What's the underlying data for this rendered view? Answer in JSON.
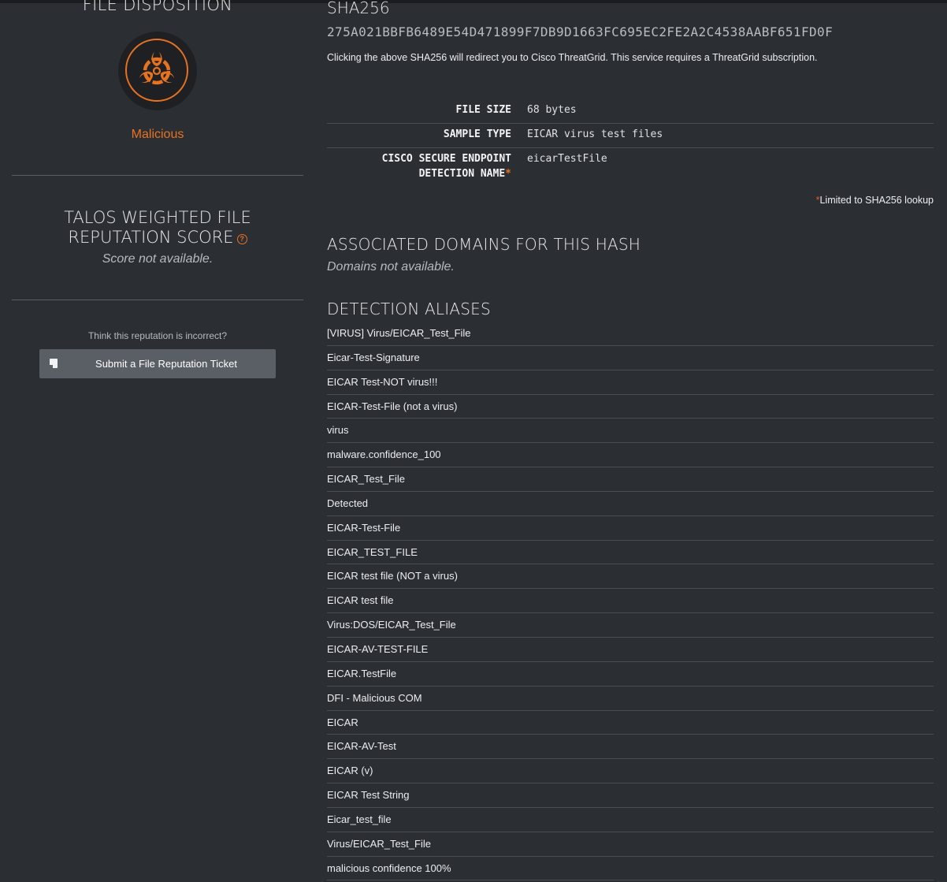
{
  "left": {
    "disposition_title": "FILE DISPOSITION",
    "disposition_icon": "biohazard-icon",
    "disposition_label": "Malicious",
    "score_title": "TALOS WEIGHTED FILE REPUTATION SCORE",
    "help_icon": "question-icon",
    "score_value": "Score not available.",
    "incorrect_prompt": "Think this reputation is incorrect?",
    "ticket_button_label": "Submit a File Reputation Ticket",
    "ticket_icon": "document-icon"
  },
  "right": {
    "sha_title": "SHA256",
    "sha_value": "275A021BBFB6489E54D471899F7DB9D1663FC695EC2FE2A2C4538AABF651FD0F",
    "sha_note": "Clicking the above SHA256 will redirect you to Cisco ThreatGrid. This service requires a ThreatGrid subscription.",
    "file_size_label": "FILE SIZE",
    "file_size_value": "68 bytes",
    "sample_type_label": "SAMPLE TYPE",
    "sample_type_value": "EICAR virus test files",
    "detection_label_line1": "CISCO SECURE ENDPOINT",
    "detection_label_line2": "DETECTION NAME",
    "detection_asterisk": "*",
    "detection_value": "eicarTestFile",
    "limit_asterisk": "*",
    "limit_note": "Limited to SHA256 lookup",
    "domains_title": "ASSOCIATED DOMAINS FOR THIS HASH",
    "domains_value": "Domains not available.",
    "aliases_title": "DETECTION ALIASES",
    "aliases": [
      "[VIRUS] Virus/EICAR_Test_File",
      "Eicar-Test-Signature",
      "EICAR Test-NOT virus!!!",
      "EICAR-Test-File (not a virus)",
      "virus",
      "malware.confidence_100",
      "EICAR_Test_File",
      "Detected",
      "EICAR-Test-File",
      "EICAR_TEST_FILE",
      "EICAR test file (NOT a virus)",
      "EICAR test file",
      "Virus:DOS/EICAR_Test_File",
      "EICAR-AV-TEST-FILE",
      "EICAR.TestFile",
      "DFI - Malicious COM",
      "EICAR",
      "EICAR-AV-Test",
      "EICAR (v)",
      "EICAR Test String",
      "Eicar_test_file",
      "Virus/EICAR_Test_File",
      "malicious confidence 100%"
    ]
  },
  "colors": {
    "background": "#2b2e33",
    "accent_orange": "#e8731f",
    "button_bg": "#5a5f66"
  }
}
